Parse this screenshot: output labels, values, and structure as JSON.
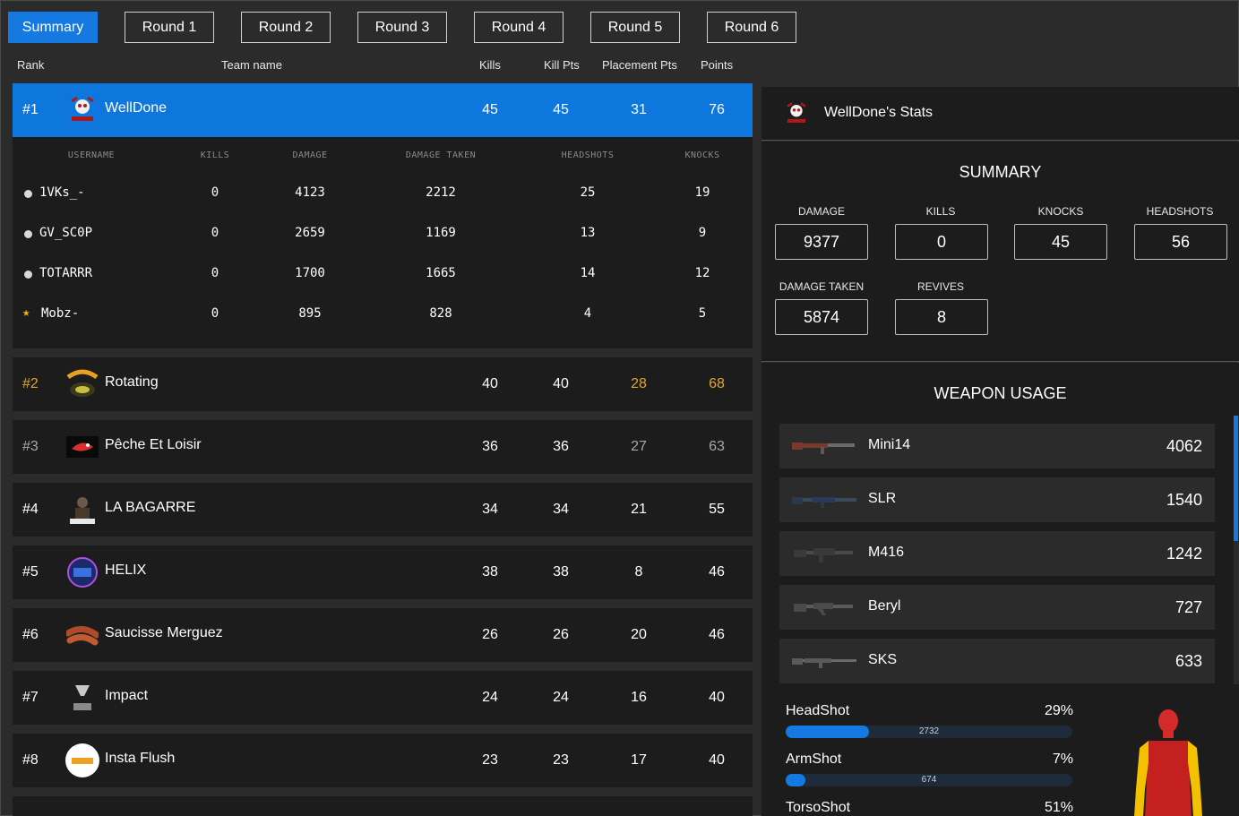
{
  "tabs": [
    "Summary",
    "Round 1",
    "Round 2",
    "Round 3",
    "Round 4",
    "Round 5",
    "Round 6"
  ],
  "columns": {
    "rank": "Rank",
    "team": "Team name",
    "kills": "Kills",
    "kill_pts": "Kill Pts",
    "placement_pts": "Placement Pts",
    "points": "Points"
  },
  "teams": [
    {
      "rank": "#1",
      "name": "WellDone",
      "kills": "45",
      "kill_pts": "45",
      "placement_pts": "31",
      "points": "76",
      "logo": "skull-logo"
    },
    {
      "rank": "#2",
      "name": "Rotating",
      "kills": "40",
      "kill_pts": "40",
      "placement_pts": "28",
      "points": "68",
      "logo": "rotating-logo"
    },
    {
      "rank": "#3",
      "name": "Pêche Et Loisir",
      "kills": "36",
      "kill_pts": "36",
      "placement_pts": "27",
      "points": "63",
      "logo": "fish-logo"
    },
    {
      "rank": "#4",
      "name": "LA BAGARRE",
      "kills": "34",
      "kill_pts": "34",
      "placement_pts": "21",
      "points": "55",
      "logo": "bagarre-logo"
    },
    {
      "rank": "#5",
      "name": "HELIX",
      "kills": "38",
      "kill_pts": "38",
      "placement_pts": "8",
      "points": "46",
      "logo": "helix-logo"
    },
    {
      "rank": "#6",
      "name": "Saucisse Merguez",
      "kills": "26",
      "kill_pts": "26",
      "placement_pts": "20",
      "points": "46",
      "logo": "sausage-logo"
    },
    {
      "rank": "#7",
      "name": "Impact",
      "kills": "24",
      "kill_pts": "24",
      "placement_pts": "16",
      "points": "40",
      "logo": "impact-logo"
    },
    {
      "rank": "#8",
      "name": "Insta Flush",
      "kills": "23",
      "kill_pts": "23",
      "placement_pts": "17",
      "points": "40",
      "logo": "flush-logo"
    }
  ],
  "player_columns": {
    "username": "USERNAME",
    "kills": "KILLS",
    "damage": "DAMAGE",
    "damage_taken": "DAMAGE TAKEN",
    "headshots": "HEADSHOTS",
    "knocks": "KNOCKS"
  },
  "players": [
    {
      "name": "1VKs_-",
      "kills": "0",
      "damage": "4123",
      "damage_taken": "2212",
      "headshots": "25",
      "knocks": "19",
      "marker": "dot"
    },
    {
      "name": "GV_SC0P",
      "kills": "0",
      "damage": "2659",
      "damage_taken": "1169",
      "headshots": "13",
      "knocks": "9",
      "marker": "dot"
    },
    {
      "name": "TOTARRR",
      "kills": "0",
      "damage": "1700",
      "damage_taken": "1665",
      "headshots": "14",
      "knocks": "12",
      "marker": "dot"
    },
    {
      "name": "Mobz-",
      "kills": "0",
      "damage": "895",
      "damage_taken": "828",
      "headshots": "4",
      "knocks": "5",
      "marker": "star"
    }
  ],
  "stats_panel": {
    "title": "WellDone's Stats",
    "summary_title": "SUMMARY",
    "stats": [
      {
        "label": "DAMAGE",
        "value": "9377"
      },
      {
        "label": "KILLS",
        "value": "0"
      },
      {
        "label": "KNOCKS",
        "value": "45"
      },
      {
        "label": "HEADSHOTS",
        "value": "56"
      },
      {
        "label": "DAMAGE TAKEN",
        "value": "5874"
      },
      {
        "label": "REVIVES",
        "value": "8"
      }
    ],
    "weapon_title": "WEAPON USAGE",
    "weapons": [
      {
        "name": "Mini14",
        "value": "4062",
        "icon": "rifle-icon"
      },
      {
        "name": "SLR",
        "value": "1540",
        "icon": "rifle-icon"
      },
      {
        "name": "M416",
        "value": "1242",
        "icon": "assault-rifle-icon"
      },
      {
        "name": "Beryl",
        "value": "727",
        "icon": "assault-rifle-icon"
      },
      {
        "name": "SKS",
        "value": "633",
        "icon": "rifle-icon"
      }
    ],
    "hits": [
      {
        "label": "HeadShot",
        "pct": "29%",
        "value": "2732",
        "fill": 0.29
      },
      {
        "label": "ArmShot",
        "pct": "7%",
        "value": "674",
        "fill": 0.07
      },
      {
        "label": "TorsoShot",
        "pct": "51%",
        "value": "",
        "fill": 0.51
      }
    ]
  },
  "colors": {
    "accent": "#1479e0",
    "gold": "#e2a52a",
    "body_head": "#d42a2a",
    "body_arm": "#f2c200"
  }
}
